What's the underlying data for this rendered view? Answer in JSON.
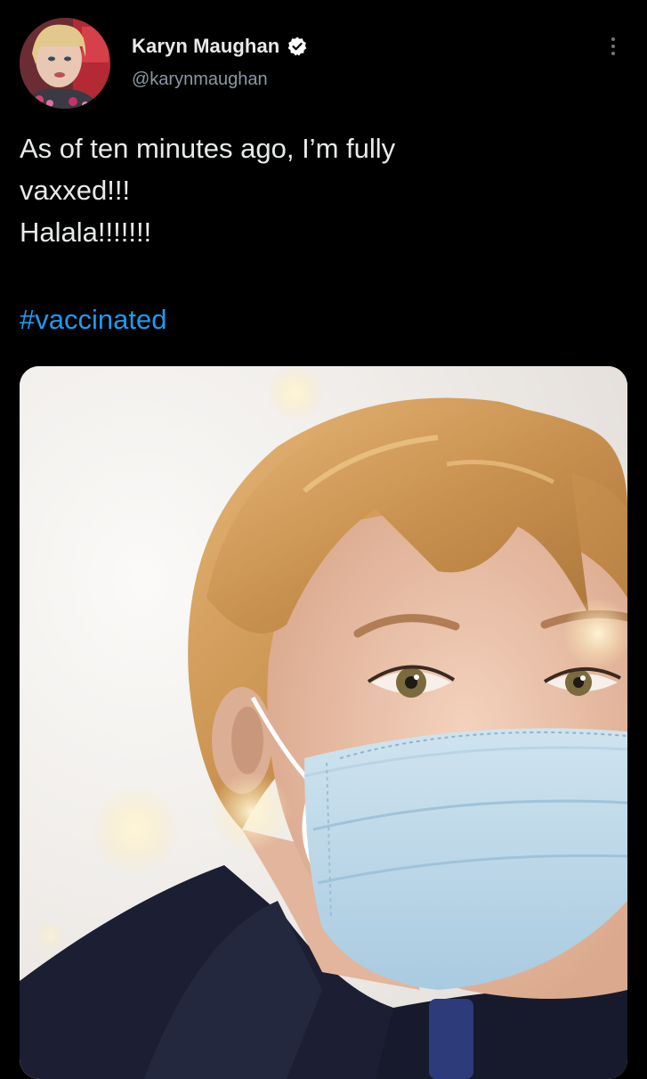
{
  "author": {
    "display_name": "Karyn Maughan",
    "handle": "@karynmaughan",
    "verified": true,
    "avatar_icon": "profile-photo"
  },
  "tweet": {
    "lines": [
      "As of ten minutes ago, I’m fully",
      "vaxxed!!!",
      "Halala!!!!!!!"
    ],
    "hashtag": "#vaccinated"
  },
  "media": {
    "type": "photo"
  },
  "colors": {
    "background": "#000000",
    "text": "#e7e9ea",
    "secondary_text": "#8b98a5",
    "link": "#1d9bf0",
    "verified_badge": "#ffffff"
  },
  "icons": {
    "verified": "verified-badge-icon",
    "more": "more-options-icon"
  }
}
